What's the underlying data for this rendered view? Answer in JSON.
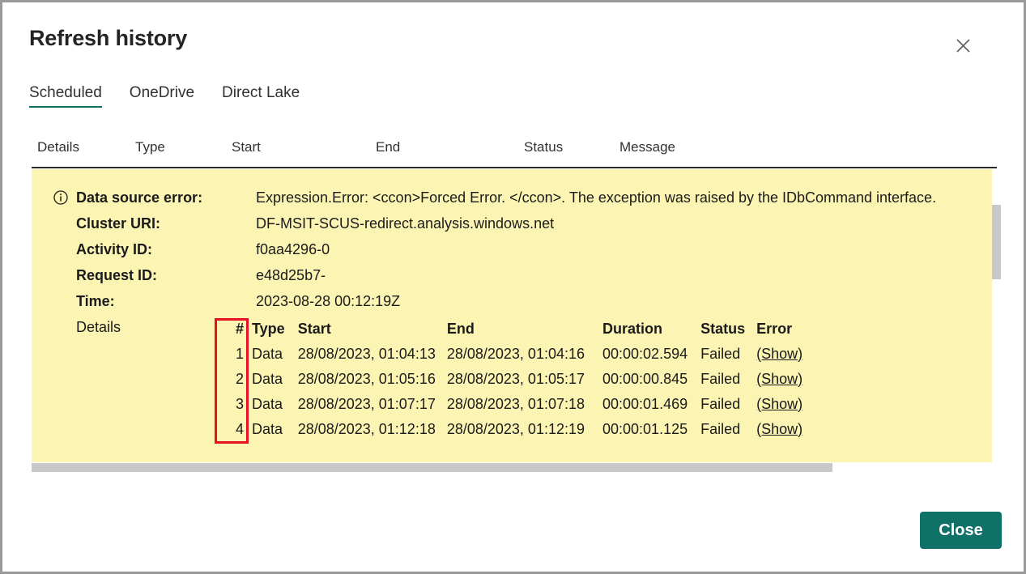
{
  "dialog": {
    "title": "Refresh history",
    "close_icon": "close-x-icon",
    "footer_button": "Close"
  },
  "tabs": [
    {
      "label": "Scheduled",
      "active": true
    },
    {
      "label": "OneDrive",
      "active": false
    },
    {
      "label": "Direct Lake",
      "active": false
    }
  ],
  "columns": {
    "details": "Details",
    "type": "Type",
    "start": "Start",
    "end": "End",
    "status": "Status",
    "message": "Message"
  },
  "error_panel": {
    "info_icon": "info-circle-icon",
    "fields": [
      {
        "label": "Data source error:",
        "value": "Expression.Error: <ccon>Forced Error. </ccon>. The exception was raised by the IDbCommand interface."
      },
      {
        "label": "Cluster URI:",
        "value": "DF-MSIT-SCUS-redirect.analysis.windows.net"
      },
      {
        "label": "Activity ID:",
        "value": "f0aa4296-0"
      },
      {
        "label": "Request ID:",
        "value": "e48d25b7-"
      },
      {
        "label": "Time:",
        "value": "2023-08-28 00:12:19Z"
      }
    ],
    "details_label": "Details",
    "details_table": {
      "headers": [
        "#",
        "Type",
        "Start",
        "End",
        "Duration",
        "Status",
        "Error"
      ],
      "rows": [
        {
          "num": "1",
          "type": "Data",
          "start": "28/08/2023, 01:04:13",
          "end": "28/08/2023, 01:04:16",
          "duration": "00:00:02.594",
          "status": "Failed",
          "error": "(Show)"
        },
        {
          "num": "2",
          "type": "Data",
          "start": "28/08/2023, 01:05:16",
          "end": "28/08/2023, 01:05:17",
          "duration": "00:00:00.845",
          "status": "Failed",
          "error": "(Show)"
        },
        {
          "num": "3",
          "type": "Data",
          "start": "28/08/2023, 01:07:17",
          "end": "28/08/2023, 01:07:18",
          "duration": "00:00:01.469",
          "status": "Failed",
          "error": "(Show)"
        },
        {
          "num": "4",
          "type": "Data",
          "start": "28/08/2023, 01:12:18",
          "end": "28/08/2023, 01:12:19",
          "duration": "00:00:01.125",
          "status": "Failed",
          "error": "(Show)"
        }
      ]
    }
  },
  "colors": {
    "panel_background": "#fcf4b2",
    "accent": "#0f7168",
    "tab_underline": "#0f6f63",
    "annotation": "#e81123",
    "scrollbar": "#c8c8c8"
  }
}
